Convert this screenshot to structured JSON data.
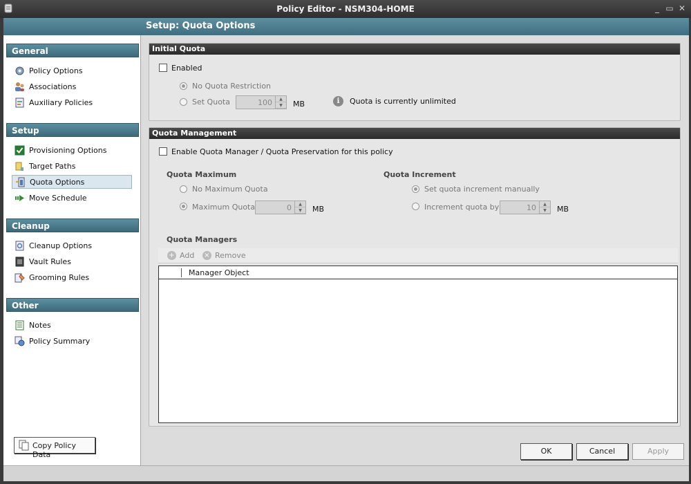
{
  "window": {
    "title": "Policy Editor - NSM304-HOME",
    "controls": [
      "_",
      "▭",
      "✕"
    ]
  },
  "header": {
    "title": "Setup: Quota Options"
  },
  "sidebar": {
    "sections": [
      {
        "title": "General",
        "items": [
          "Policy Options",
          "Associations",
          "Auxiliary Policies"
        ]
      },
      {
        "title": "Setup",
        "items": [
          "Provisioning Options",
          "Target Paths",
          "Quota Options",
          "Move Schedule"
        ]
      },
      {
        "title": "Cleanup",
        "items": [
          "Cleanup Options",
          "Vault Rules",
          "Grooming Rules"
        ]
      },
      {
        "title": "Other",
        "items": [
          "Notes",
          "Policy Summary"
        ]
      }
    ],
    "selected": "Quota Options",
    "copy_button": "Copy Policy Data"
  },
  "initial_quota": {
    "title": "Initial Quota",
    "enabled_label": "Enabled",
    "enabled": false,
    "no_restriction_label": "No Quota Restriction",
    "set_quota_label": "Set Quota",
    "set_quota_value": "100",
    "unit": "MB",
    "info_text": "Quota is currently unlimited"
  },
  "quota_management": {
    "title": "Quota Management",
    "enable_label": "Enable Quota Manager / Quota Preservation for this policy",
    "enabled": false,
    "maximum": {
      "title": "Quota Maximum",
      "no_max_label": "No Maximum Quota",
      "max_label": "Maximum Quota",
      "max_value": "0",
      "unit": "MB"
    },
    "increment": {
      "title": "Quota Increment",
      "manual_label": "Set quota increment manually",
      "by_label": "Increment quota by",
      "by_value": "10",
      "unit": "MB"
    },
    "managers": {
      "title": "Quota Managers",
      "add_label": "Add",
      "remove_label": "Remove",
      "column": "Manager Object"
    }
  },
  "footer": {
    "ok": "OK",
    "cancel": "Cancel",
    "apply": "Apply"
  },
  "colors": {
    "accent": "#4a7c8e",
    "panel_head": "#2f2f2f",
    "background": "#dcdcdc"
  }
}
